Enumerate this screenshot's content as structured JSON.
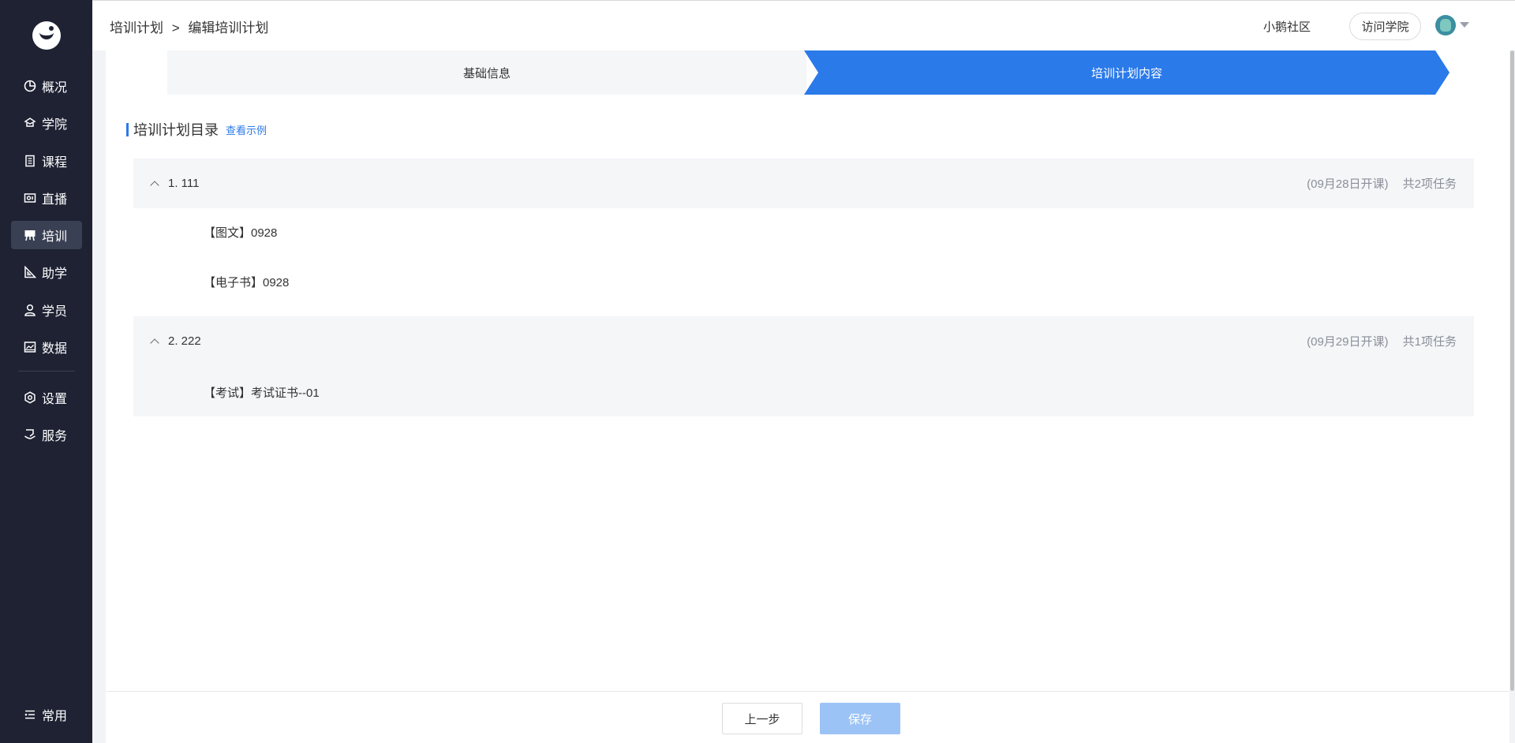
{
  "sidebar": {
    "items": [
      {
        "label": "概况",
        "icon": "overview-icon"
      },
      {
        "label": "学院",
        "icon": "academy-icon"
      },
      {
        "label": "课程",
        "icon": "course-icon"
      },
      {
        "label": "直播",
        "icon": "live-icon"
      },
      {
        "label": "培训",
        "icon": "training-icon",
        "active": true
      },
      {
        "label": "助学",
        "icon": "study-aid-icon"
      },
      {
        "label": "学员",
        "icon": "student-icon"
      },
      {
        "label": "数据",
        "icon": "data-icon"
      },
      {
        "label": "设置",
        "icon": "settings-icon"
      },
      {
        "label": "服务",
        "icon": "service-icon"
      }
    ],
    "common_label": "常用"
  },
  "header": {
    "breadcrumb": {
      "parent": "培训计划",
      "separator": ">",
      "current": "编辑培训计划"
    },
    "community": "小鹅社区",
    "visit_button": "访问学院"
  },
  "steps": {
    "step1": "基础信息",
    "step2": "培训计划内容"
  },
  "section": {
    "title": "培训计划目录",
    "example_link": "查看示例"
  },
  "chapters": [
    {
      "title": "1. 111",
      "start": "(09月28日开课)",
      "count": "共2项任务",
      "tasks": [
        "【图文】0928",
        "【电子书】0928"
      ]
    },
    {
      "title": "2. 222",
      "start": "(09月29日开课)",
      "count": "共1项任务",
      "tasks": [
        "【考试】考试证书--01"
      ]
    }
  ],
  "footer": {
    "prev_button": "上一步",
    "save_button": "保存"
  },
  "colors": {
    "sidebar_bg": "#1e2233",
    "primary": "#2b7ae9",
    "save_disabled": "#9cc3f5"
  }
}
